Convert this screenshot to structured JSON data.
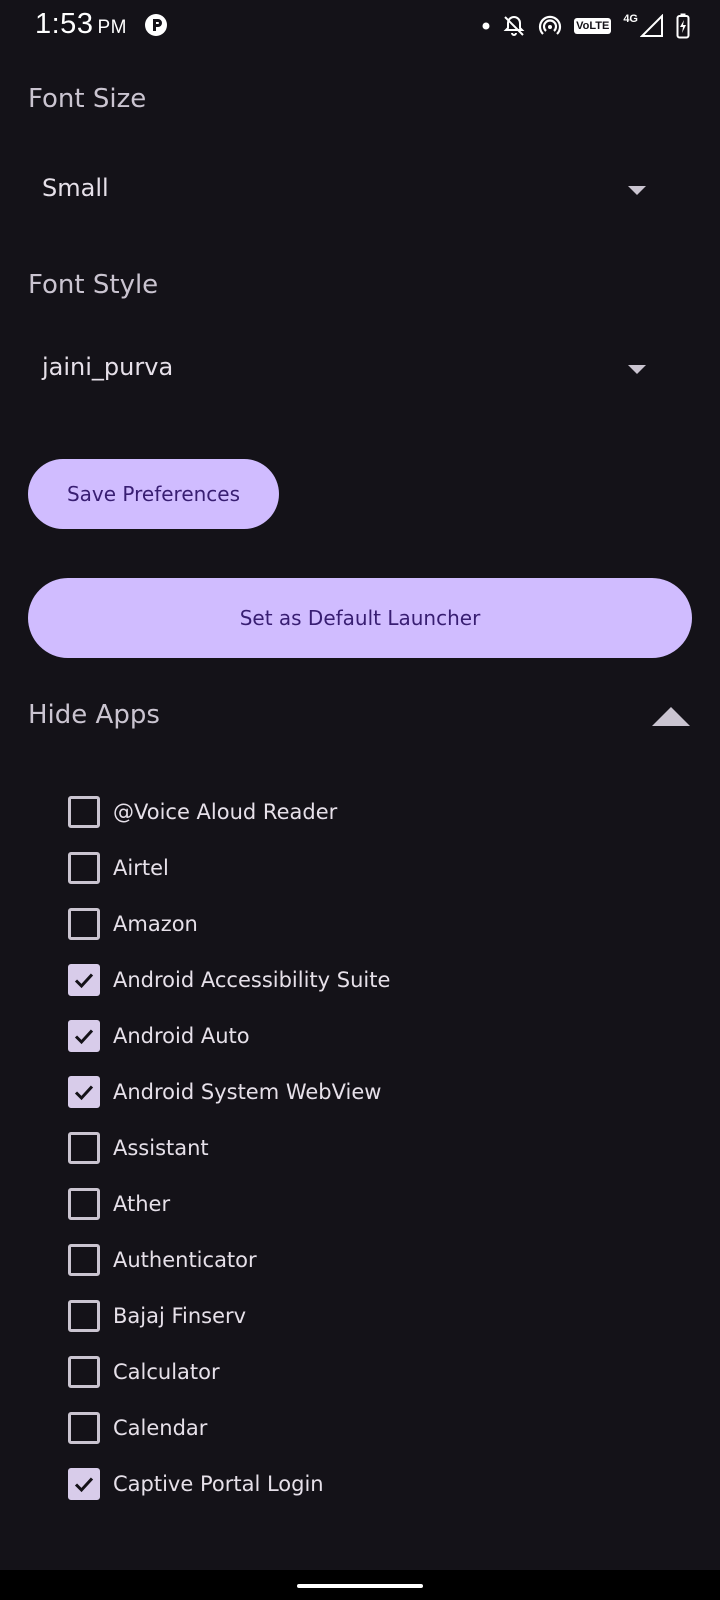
{
  "status_bar": {
    "time": "1:53",
    "ampm": "PM",
    "volte": "VoLTE",
    "network": "4G"
  },
  "settings": {
    "font_size_label": "Font Size",
    "font_size_value": "Small",
    "font_style_label": "Font Style",
    "font_style_value": "jaini_purva",
    "save_button": "Save Preferences",
    "launcher_button": "Set as Default Launcher",
    "hide_apps_label": "Hide Apps"
  },
  "apps": [
    {
      "name": "@Voice Aloud Reader",
      "checked": false
    },
    {
      "name": "Airtel",
      "checked": false
    },
    {
      "name": "Amazon",
      "checked": false
    },
    {
      "name": "Android Accessibility Suite",
      "checked": true
    },
    {
      "name": "Android Auto",
      "checked": true
    },
    {
      "name": "Android System WebView",
      "checked": true
    },
    {
      "name": "Assistant",
      "checked": false
    },
    {
      "name": "Ather",
      "checked": false
    },
    {
      "name": "Authenticator",
      "checked": false
    },
    {
      "name": "Bajaj Finserv",
      "checked": false
    },
    {
      "name": "Calculator",
      "checked": false
    },
    {
      "name": "Calendar",
      "checked": false
    },
    {
      "name": "Captive Portal Login",
      "checked": true
    }
  ],
  "colors": {
    "background": "#141218",
    "button": "#d0bcff",
    "button_text": "#381e72",
    "checkbox_checked": "#d8ccea"
  }
}
